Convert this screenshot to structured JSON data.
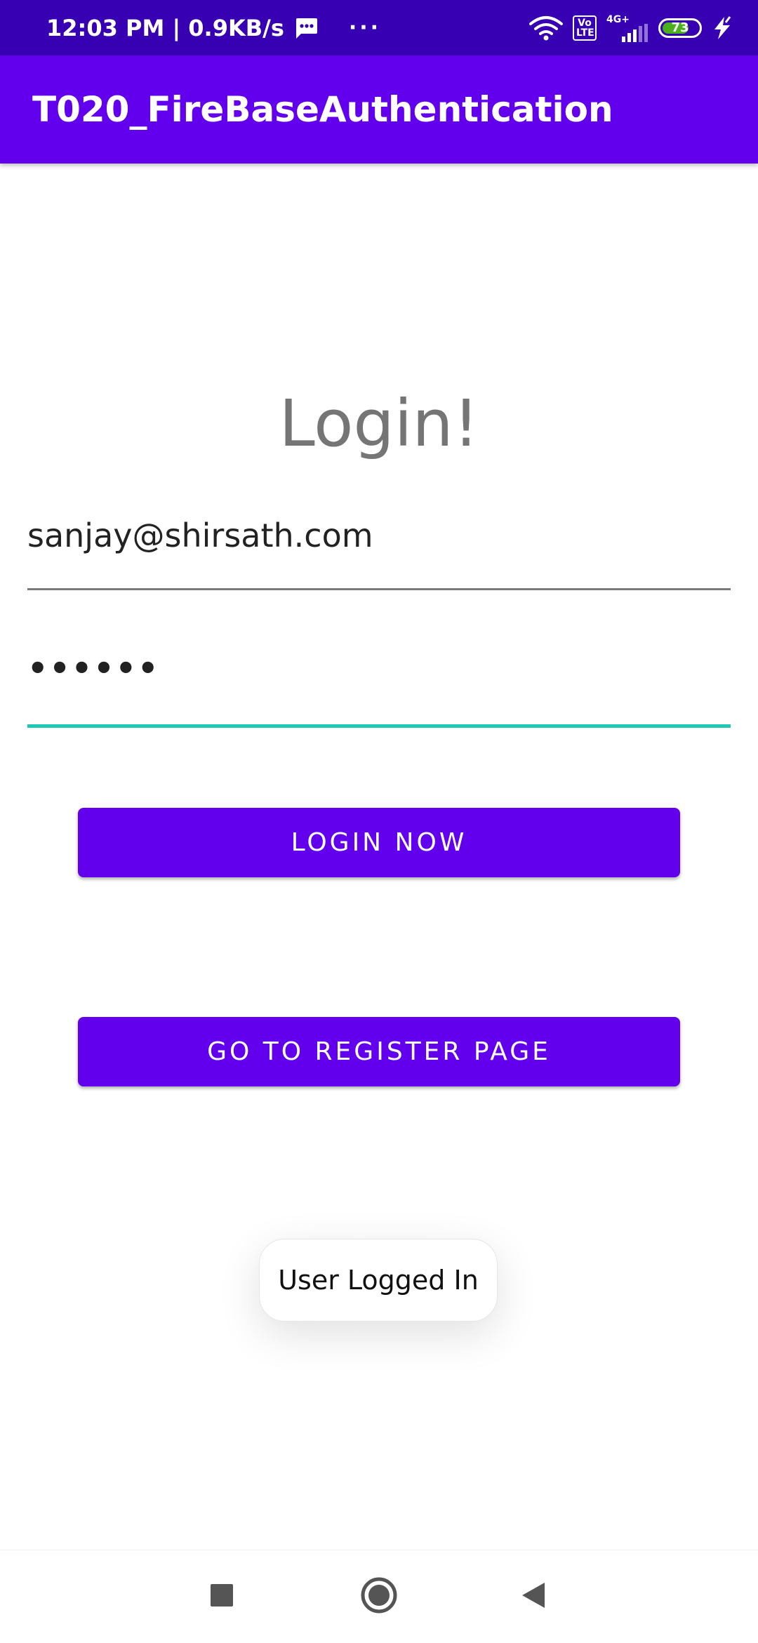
{
  "status_bar": {
    "time_speed": "12:03 PM | 0.9KB/s",
    "overflow_dots": "···",
    "volte_label": "Vo LTE",
    "network_type": "4G+",
    "battery_level": "73",
    "battery_fill_percent": 73,
    "battery_color": "#4caf1c"
  },
  "app_bar": {
    "title": "T020_FireBaseAuthentication",
    "color": "#6200ee"
  },
  "login_form": {
    "heading": "Login!",
    "email_value": "sanjay@shirsath.com",
    "password_value": "••••••",
    "login_button": "LOGIN NOW",
    "register_button": "GO TO REGISTER PAGE",
    "focus_color": "#1ec8b4"
  },
  "toast": {
    "message": "User Logged In"
  },
  "navigation": {
    "recents_icon": "square-icon",
    "home_icon": "circle-icon",
    "back_icon": "triangle-back-icon"
  }
}
